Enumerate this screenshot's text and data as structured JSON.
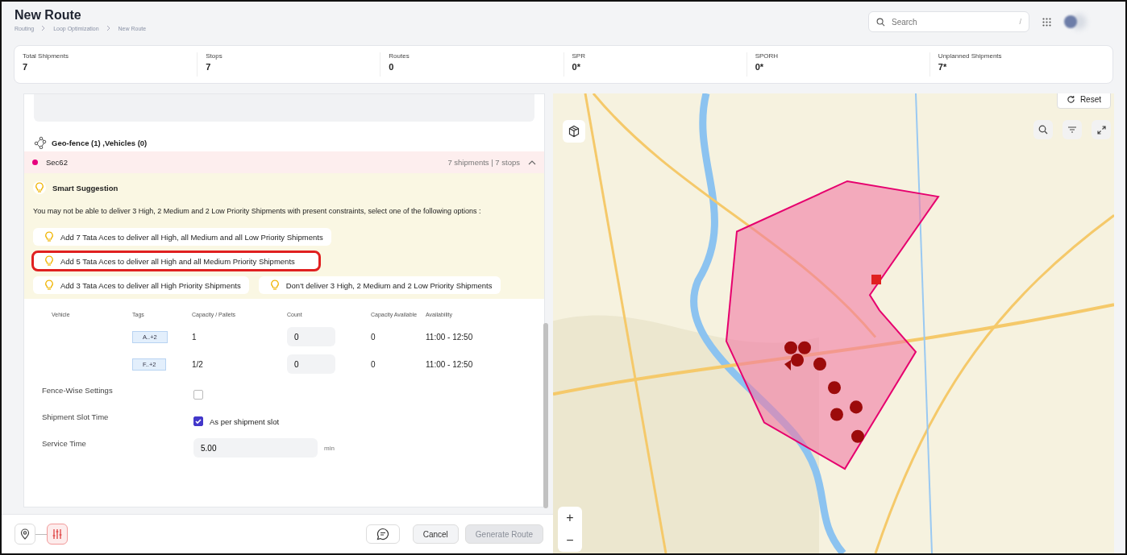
{
  "header": {
    "title": "New Route",
    "breadcrumb": [
      "Routing",
      "Loop Optimization",
      "New Route"
    ],
    "search": {
      "placeholder": "Search",
      "shortcut": "/"
    }
  },
  "stats": [
    {
      "label": "Total Shipments",
      "value": "7"
    },
    {
      "label": "Stops",
      "value": "7"
    },
    {
      "label": "Routes",
      "value": "0"
    },
    {
      "label": "SPR",
      "value": "0*"
    },
    {
      "label": "SPORH",
      "value": "0*"
    },
    {
      "label": "Unplanned Shipments",
      "value": "7*"
    }
  ],
  "geofence_section": {
    "title": "Geo-fence (1) ,Vehicles (0)",
    "fence": {
      "name": "Sec62",
      "color": "#e6007e",
      "summary": "7 shipments | 7 stops",
      "expanded": true
    }
  },
  "smart_suggestion": {
    "title": "Smart Suggestion",
    "message": "You may not be able to deliver 3 High, 2 Medium and 2 Low Priority Shipments with present constraints, select one of the following options :",
    "options": [
      {
        "label": "Add 7 Tata Aces to deliver all High, all Medium and all Low Priority Shipments",
        "highlighted": false
      },
      {
        "label": "Add 5 Tata Aces to deliver all High and all Medium Priority Shipments",
        "highlighted": true
      },
      {
        "label": "Add 3 Tata Aces to deliver all High Priority Shipments",
        "highlighted": false
      },
      {
        "label": "Don't deliver 3 High, 2 Medium and 2 Low Priority Shipments",
        "highlighted": false
      }
    ]
  },
  "vehicle_table": {
    "columns": [
      "Vehicle",
      "Tags",
      "Capacity / Pallets",
      "Count",
      "Capacity Available",
      "Availability"
    ],
    "rows": [
      {
        "tag": "A..+2",
        "capacity": "1",
        "count": "0",
        "capacity_available": "0",
        "availability": "11:00 - 12:50"
      },
      {
        "tag": "F..+2",
        "capacity": "1/2",
        "count": "0",
        "capacity_available": "0",
        "availability": "11:00 - 12:50"
      }
    ]
  },
  "settings": {
    "fence_wise": {
      "label": "Fence-Wise Settings",
      "checked": false
    },
    "slot_time": {
      "label": "Shipment Slot Time",
      "checked": true,
      "option": "As per shipment slot"
    },
    "service_time": {
      "label": "Service Time",
      "value": "5.00",
      "unit": "min"
    }
  },
  "map": {
    "kind": "picture",
    "reset": "Reset",
    "zoom_in": "+",
    "zoom_out": "−"
  },
  "footer": {
    "steps": [
      {
        "kind": "location",
        "selected": false
      },
      {
        "kind": "settings",
        "selected": true
      }
    ],
    "cancel": "Cancel",
    "generate": {
      "label": "Generate Route",
      "disabled": true
    }
  }
}
